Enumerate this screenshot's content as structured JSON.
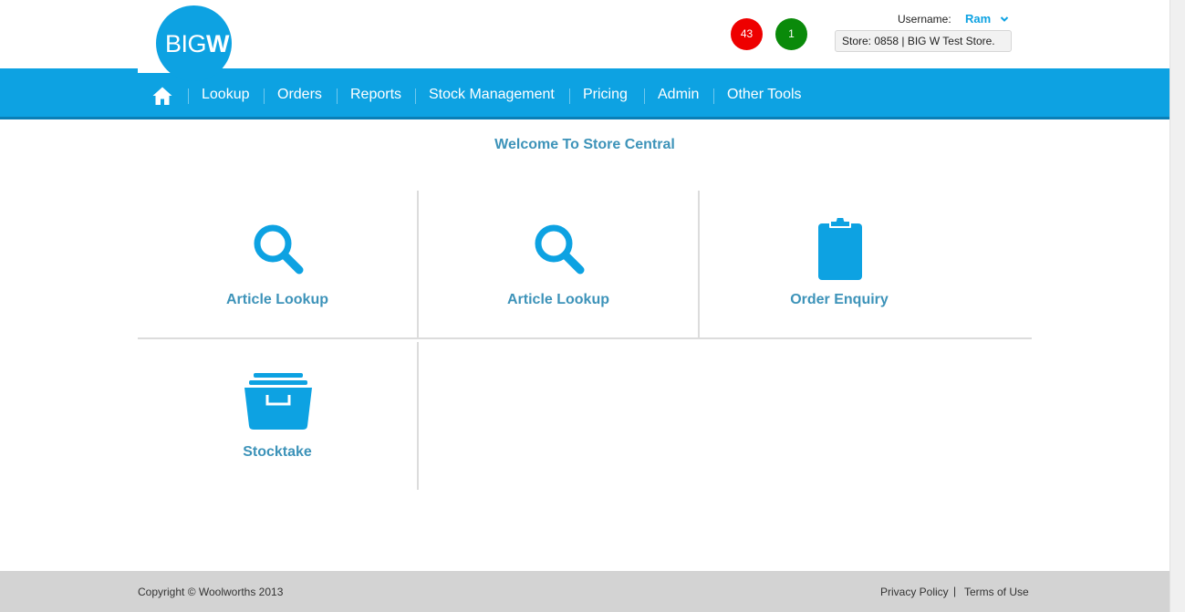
{
  "logo": {
    "text_light": "BIG",
    "text_bold": "W"
  },
  "alerts": {
    "red_count": "43",
    "green_count": "1",
    "red_color": "#ee0000",
    "green_color": "#0a8a0a"
  },
  "user": {
    "label": "Username:",
    "name": "Ram",
    "store": "Store: 0858 | BIG W Test Store."
  },
  "nav": {
    "home_icon": "home-icon",
    "items": [
      {
        "label": "Lookup"
      },
      {
        "label": "Orders"
      },
      {
        "label": "Reports"
      },
      {
        "label": "Stock Management"
      },
      {
        "label": "Pricing"
      },
      {
        "label": "Admin"
      },
      {
        "label": "Other Tools"
      }
    ]
  },
  "main": {
    "welcome": "Welcome To Store Central",
    "tiles": [
      {
        "label": "Article Lookup",
        "icon": "search-icon"
      },
      {
        "label": "Article Lookup",
        "icon": "search-icon"
      },
      {
        "label": "Order Enquiry",
        "icon": "clipboard-icon"
      },
      {
        "label": "Stocktake",
        "icon": "archive-box-icon"
      }
    ]
  },
  "footer": {
    "copyright": "Copyright © Woolworths 2013",
    "privacy": "Privacy Policy",
    "separator": "|",
    "terms": "Terms of Use"
  },
  "colors": {
    "brand": "#0da2e2",
    "heading": "#3d93b9",
    "footer_bg": "#d3d3d3"
  }
}
